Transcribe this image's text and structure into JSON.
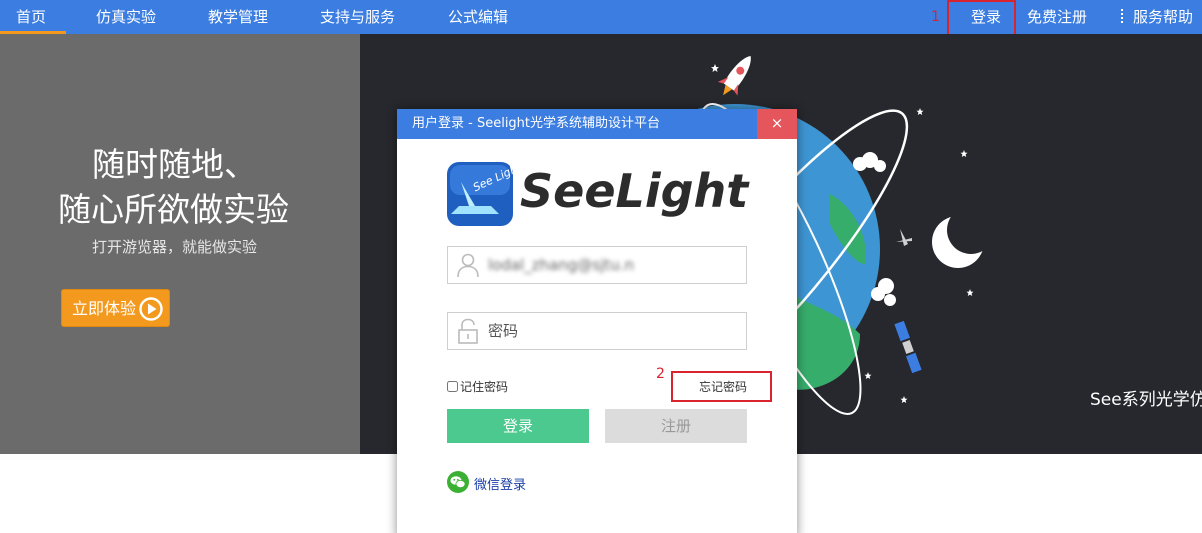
{
  "nav": {
    "items": [
      "首页",
      "仿真实验",
      "教学管理",
      "支持与服务",
      "公式编辑"
    ],
    "login": "登录",
    "register": "免费注册",
    "help": "服务帮助"
  },
  "annotations": {
    "one": "1",
    "two": "2"
  },
  "hero": {
    "title_line1": "随时随地、",
    "title_line2": "随心所欲做实验",
    "subtitle": "打开游览器，就能做实验",
    "cta": "立即体验",
    "caption": "See系列光学仿"
  },
  "dialog": {
    "title": "用户登录 - Seelight光学系统辅助设计平台",
    "close": "×",
    "logo_text": "SeeLight",
    "logo_icon_text": "See Light",
    "username_value": "lodal_zhang@sjtu.n",
    "password_placeholder": "密码",
    "remember_label": "记住密码",
    "forgot_label": "忘记密码",
    "login_button": "登录",
    "register_button": "注册",
    "wechat_label": "微信登录"
  },
  "colors": {
    "nav_bg": "#3b7de0",
    "accent_orange": "#f39a1e",
    "annotation_red": "#d9232e",
    "login_green": "#4cc98e",
    "close_red": "#e4565b",
    "hero_left_bg": "#6b6b6b",
    "hero_right_bg": "#26282d"
  }
}
